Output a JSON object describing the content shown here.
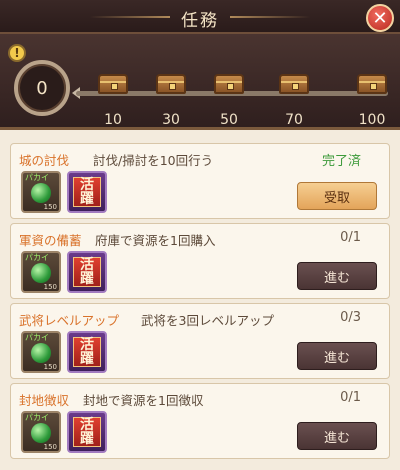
{
  "header": {
    "title": "任務",
    "close_label": "✕"
  },
  "progress": {
    "points": "0",
    "warn_symbol": "!",
    "milestones": [
      "10",
      "30",
      "50",
      "70",
      "100"
    ]
  },
  "tasks": [
    {
      "name": "城の討伐",
      "desc": "討伐/掃討を10回行う",
      "status": "完了済",
      "button": "受取",
      "done": true,
      "jade_tag": "パカイ",
      "jade_count": "150"
    },
    {
      "name": "軍資の備蓄",
      "desc": "府庫で資源を1回購入",
      "status": "0/1",
      "button": "進む",
      "done": false,
      "jade_tag": "パカイ",
      "jade_count": "150"
    },
    {
      "name": "武将レベルアップ",
      "desc": "武将を3回レベルアップ",
      "status": "0/3",
      "button": "進む",
      "done": false,
      "jade_tag": "パカイ",
      "jade_count": "150"
    },
    {
      "name": "封地徴収",
      "desc": "封地で資源を1回徴収",
      "status": "0/1",
      "button": "進む",
      "done": false,
      "jade_tag": "パカイ",
      "jade_count": "150"
    }
  ],
  "reward_scroll_text": [
    "活",
    "躍"
  ],
  "colors": {
    "accent": "#d9722a",
    "done": "#3c9a3a",
    "close": "#c9362b"
  }
}
